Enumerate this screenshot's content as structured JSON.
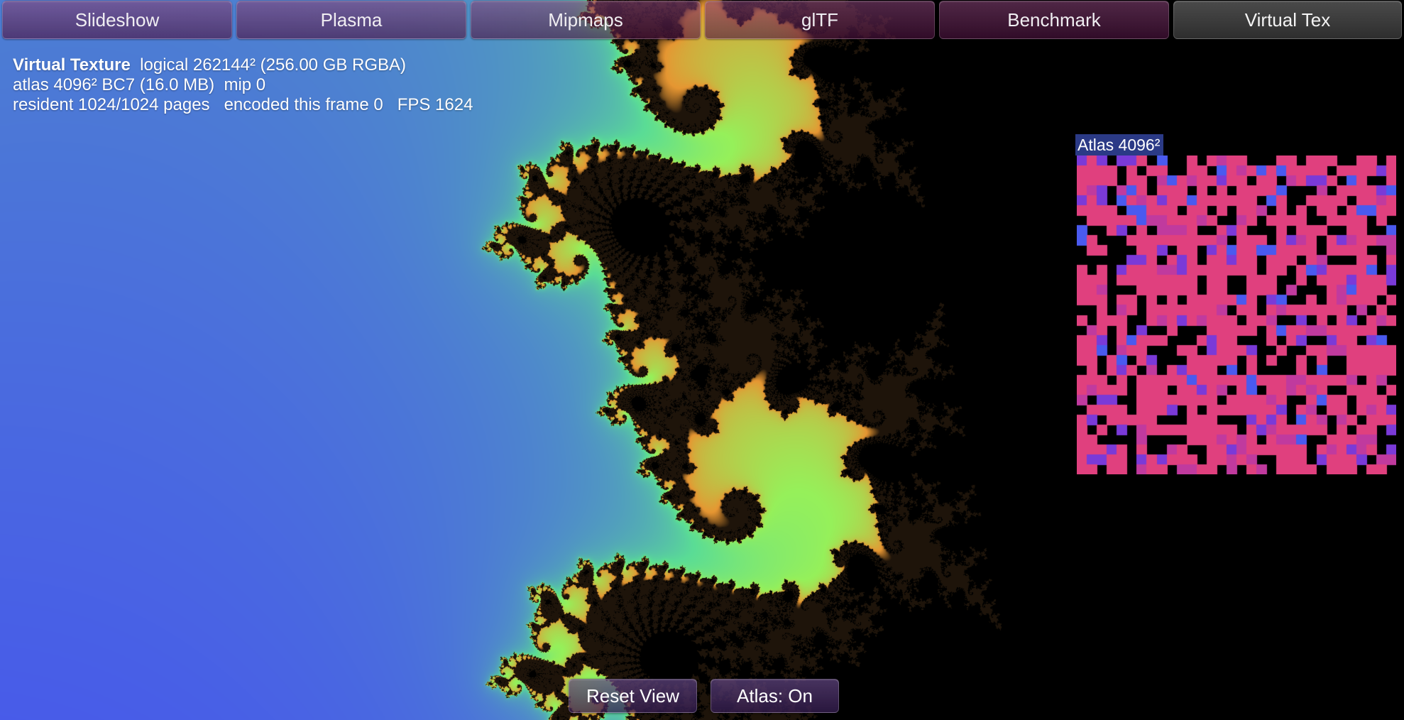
{
  "tabs": [
    {
      "label": "Slideshow",
      "active": false
    },
    {
      "label": "Plasma",
      "active": false
    },
    {
      "label": "Mipmaps",
      "active": false
    },
    {
      "label": "glTF",
      "active": false
    },
    {
      "label": "Benchmark",
      "active": false
    },
    {
      "label": "Virtual Tex",
      "active": true
    }
  ],
  "info": {
    "title": "Virtual Texture",
    "line1_rest": "  logical 262144² (256.00 GB RGBA)",
    "line2": "atlas 4096² BC7 (16.0 MB)  mip 0",
    "line3": "resident 1024/1024 pages   encoded this frame 0   FPS 1624"
  },
  "atlas": {
    "label": "Atlas 4096²"
  },
  "buttons": {
    "reset_view": "Reset View",
    "atlas_toggle": "Atlas: On"
  },
  "colors": {
    "background_magenta": "#d9347e",
    "fractal_purple": "#8a2be2",
    "fractal_blue": "#3f56f0",
    "fractal_green": "#6cf07a",
    "set_interior": "#000000",
    "atlas_label_bg": "#2b3a86",
    "active_tab": "#3a3a3a"
  }
}
